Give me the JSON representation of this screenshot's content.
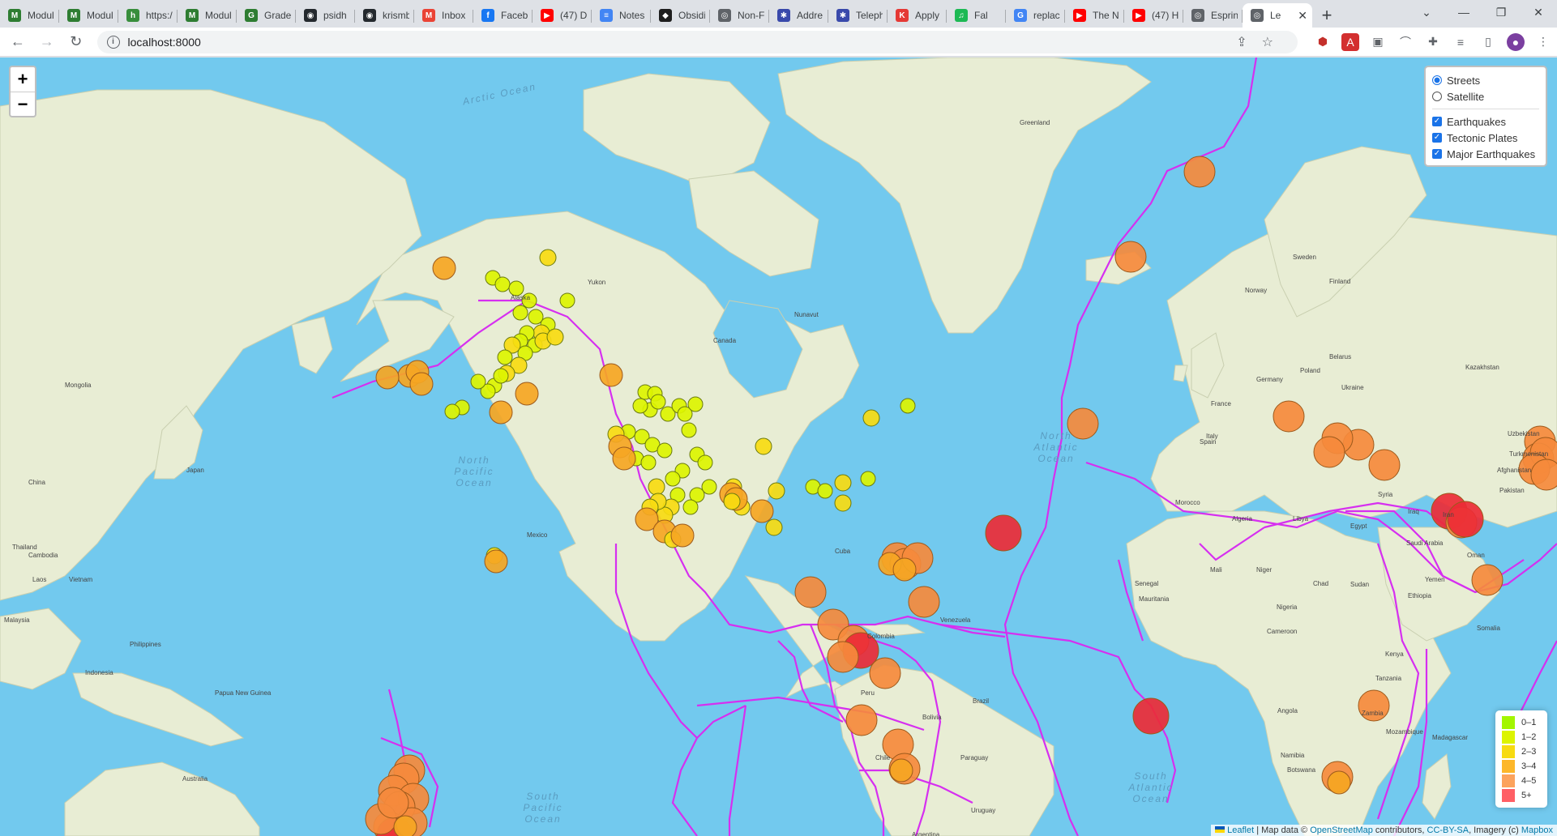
{
  "browser": {
    "tabs": [
      {
        "title": "Modul",
        "color": "#2e7d32",
        "glyph": "M"
      },
      {
        "title": "Modul",
        "color": "#2e7d32",
        "glyph": "M"
      },
      {
        "title": "https:/",
        "color": "#388e3c",
        "glyph": "h"
      },
      {
        "title": "Modul",
        "color": "#2e7d32",
        "glyph": "M"
      },
      {
        "title": "Grade",
        "color": "#2e7d32",
        "glyph": "G"
      },
      {
        "title": "psidh",
        "color": "#24292e",
        "glyph": "◉"
      },
      {
        "title": "krismb",
        "color": "#24292e",
        "glyph": "◉"
      },
      {
        "title": "Inbox",
        "color": "#ea4335",
        "glyph": "M"
      },
      {
        "title": "Faceb",
        "color": "#1877f2",
        "glyph": "f"
      },
      {
        "title": "(47) D",
        "color": "#ff0000",
        "glyph": "▶"
      },
      {
        "title": "Notes",
        "color": "#4285f4",
        "glyph": "≡"
      },
      {
        "title": "Obsidi",
        "color": "#1e1e1e",
        "glyph": "◆"
      },
      {
        "title": "Non-F",
        "color": "#5f6368",
        "glyph": "◎"
      },
      {
        "title": "Addre",
        "color": "#3949ab",
        "glyph": "✱"
      },
      {
        "title": "Teleph",
        "color": "#3949ab",
        "glyph": "✱"
      },
      {
        "title": "Apply",
        "color": "#e53935",
        "glyph": "K"
      },
      {
        "title": "Fal",
        "color": "#1db954",
        "glyph": "♫"
      },
      {
        "title": "replac",
        "color": "#4285f4",
        "glyph": "G"
      },
      {
        "title": "The N",
        "color": "#ff0000",
        "glyph": "▶"
      },
      {
        "title": "(47) H",
        "color": "#ff0000",
        "glyph": "▶"
      },
      {
        "title": "Esprin",
        "color": "#5f6368",
        "glyph": "◎"
      }
    ],
    "active_tab": {
      "title": "Le",
      "glyph": "◎"
    },
    "url": "localhost:8000"
  },
  "layer_control": {
    "base_layers": [
      {
        "label": "Streets",
        "selected": true
      },
      {
        "label": "Satellite",
        "selected": false
      }
    ],
    "overlays": [
      {
        "label": "Earthquakes",
        "checked": true
      },
      {
        "label": "Tectonic Plates",
        "checked": true
      },
      {
        "label": "Major Earthquakes",
        "checked": true
      }
    ]
  },
  "legend": {
    "items": [
      {
        "label": "0–1",
        "color": "#a3f600"
      },
      {
        "label": "1–2",
        "color": "#dcf400"
      },
      {
        "label": "2–3",
        "color": "#f7db11"
      },
      {
        "label": "3–4",
        "color": "#fdb72a"
      },
      {
        "label": "4–5",
        "color": "#fca35d"
      },
      {
        "label": "5+",
        "color": "#ff5f65"
      }
    ]
  },
  "attribution": {
    "leaflet": "Leaflet",
    "text1": " | Map data © ",
    "osm": "OpenStreetMap",
    "text2": " contributors, ",
    "license": "CC-BY-SA",
    "text3": ", Imagery (c) ",
    "mapbox": "Mapbox"
  },
  "map_labels": {
    "oceans": [
      "Arctic Ocean",
      "North Pacific Ocean",
      "North Atlantic Ocean",
      "South Pacific Ocean",
      "South Atlantic Ocean"
    ],
    "places": [
      "Greenland",
      "Canada",
      "Mexico",
      "Cuba",
      "Colombia",
      "Venezuela",
      "Peru",
      "Brazil",
      "Bolivia",
      "Argentina",
      "Chile",
      "Paraguay",
      "Uruguay",
      "Spain",
      "France",
      "Italy",
      "Germany",
      "Poland",
      "Ukraine",
      "Belarus",
      "Sweden",
      "Norway",
      "Finland",
      "Kazakhstan",
      "Mongolia",
      "China",
      "Japan",
      "Thailand",
      "Cambodia",
      "Indonesia",
      "Papua New Guinea",
      "Australia",
      "Algeria",
      "Libya",
      "Egypt",
      "Mali",
      "Niger",
      "Chad",
      "Sudan",
      "Ethiopia",
      "Nigeria",
      "Kenya",
      "Tanzania",
      "Angola",
      "Zambia",
      "Namibia",
      "Botswana",
      "Mozambique",
      "Madagascar",
      "Saudi Arabia",
      "Iran",
      "Oman",
      "Yemen",
      "Pakistan",
      "Afghanistan",
      "Turkmenistan",
      "Uzbekistan",
      "Somalia",
      "Cameroon",
      "Senegal",
      "Mauritania",
      "Morocco",
      "Syria",
      "Iraq",
      "Philippines",
      "Laos",
      "Vietnam",
      "Malaysia",
      "Alaska",
      "Yukon",
      "Nunavut"
    ]
  },
  "markers_by_magnitude": {
    "0-1": "#a3f600",
    "1-2": "#dcf400",
    "2-3": "#f7db11",
    "3-4": "#fdb72a",
    "4-5": "#fca35d",
    "5+": "#ff5f65"
  }
}
